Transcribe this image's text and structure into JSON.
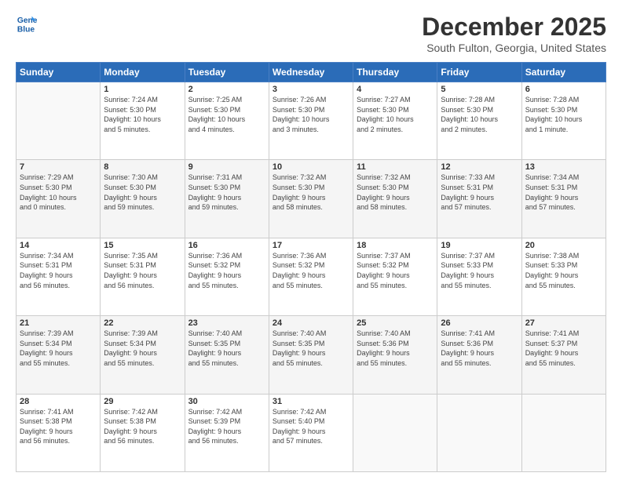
{
  "header": {
    "logo_line1": "General",
    "logo_line2": "Blue",
    "title": "December 2025",
    "subtitle": "South Fulton, Georgia, United States"
  },
  "days_of_week": [
    "Sunday",
    "Monday",
    "Tuesday",
    "Wednesday",
    "Thursday",
    "Friday",
    "Saturday"
  ],
  "weeks": [
    [
      {
        "day": "",
        "info": ""
      },
      {
        "day": "1",
        "info": "Sunrise: 7:24 AM\nSunset: 5:30 PM\nDaylight: 10 hours\nand 5 minutes."
      },
      {
        "day": "2",
        "info": "Sunrise: 7:25 AM\nSunset: 5:30 PM\nDaylight: 10 hours\nand 4 minutes."
      },
      {
        "day": "3",
        "info": "Sunrise: 7:26 AM\nSunset: 5:30 PM\nDaylight: 10 hours\nand 3 minutes."
      },
      {
        "day": "4",
        "info": "Sunrise: 7:27 AM\nSunset: 5:30 PM\nDaylight: 10 hours\nand 2 minutes."
      },
      {
        "day": "5",
        "info": "Sunrise: 7:28 AM\nSunset: 5:30 PM\nDaylight: 10 hours\nand 2 minutes."
      },
      {
        "day": "6",
        "info": "Sunrise: 7:28 AM\nSunset: 5:30 PM\nDaylight: 10 hours\nand 1 minute."
      }
    ],
    [
      {
        "day": "7",
        "info": "Sunrise: 7:29 AM\nSunset: 5:30 PM\nDaylight: 10 hours\nand 0 minutes."
      },
      {
        "day": "8",
        "info": "Sunrise: 7:30 AM\nSunset: 5:30 PM\nDaylight: 9 hours\nand 59 minutes."
      },
      {
        "day": "9",
        "info": "Sunrise: 7:31 AM\nSunset: 5:30 PM\nDaylight: 9 hours\nand 59 minutes."
      },
      {
        "day": "10",
        "info": "Sunrise: 7:32 AM\nSunset: 5:30 PM\nDaylight: 9 hours\nand 58 minutes."
      },
      {
        "day": "11",
        "info": "Sunrise: 7:32 AM\nSunset: 5:30 PM\nDaylight: 9 hours\nand 58 minutes."
      },
      {
        "day": "12",
        "info": "Sunrise: 7:33 AM\nSunset: 5:31 PM\nDaylight: 9 hours\nand 57 minutes."
      },
      {
        "day": "13",
        "info": "Sunrise: 7:34 AM\nSunset: 5:31 PM\nDaylight: 9 hours\nand 57 minutes."
      }
    ],
    [
      {
        "day": "14",
        "info": "Sunrise: 7:34 AM\nSunset: 5:31 PM\nDaylight: 9 hours\nand 56 minutes."
      },
      {
        "day": "15",
        "info": "Sunrise: 7:35 AM\nSunset: 5:31 PM\nDaylight: 9 hours\nand 56 minutes."
      },
      {
        "day": "16",
        "info": "Sunrise: 7:36 AM\nSunset: 5:32 PM\nDaylight: 9 hours\nand 55 minutes."
      },
      {
        "day": "17",
        "info": "Sunrise: 7:36 AM\nSunset: 5:32 PM\nDaylight: 9 hours\nand 55 minutes."
      },
      {
        "day": "18",
        "info": "Sunrise: 7:37 AM\nSunset: 5:32 PM\nDaylight: 9 hours\nand 55 minutes."
      },
      {
        "day": "19",
        "info": "Sunrise: 7:37 AM\nSunset: 5:33 PM\nDaylight: 9 hours\nand 55 minutes."
      },
      {
        "day": "20",
        "info": "Sunrise: 7:38 AM\nSunset: 5:33 PM\nDaylight: 9 hours\nand 55 minutes."
      }
    ],
    [
      {
        "day": "21",
        "info": "Sunrise: 7:39 AM\nSunset: 5:34 PM\nDaylight: 9 hours\nand 55 minutes."
      },
      {
        "day": "22",
        "info": "Sunrise: 7:39 AM\nSunset: 5:34 PM\nDaylight: 9 hours\nand 55 minutes."
      },
      {
        "day": "23",
        "info": "Sunrise: 7:40 AM\nSunset: 5:35 PM\nDaylight: 9 hours\nand 55 minutes."
      },
      {
        "day": "24",
        "info": "Sunrise: 7:40 AM\nSunset: 5:35 PM\nDaylight: 9 hours\nand 55 minutes."
      },
      {
        "day": "25",
        "info": "Sunrise: 7:40 AM\nSunset: 5:36 PM\nDaylight: 9 hours\nand 55 minutes."
      },
      {
        "day": "26",
        "info": "Sunrise: 7:41 AM\nSunset: 5:36 PM\nDaylight: 9 hours\nand 55 minutes."
      },
      {
        "day": "27",
        "info": "Sunrise: 7:41 AM\nSunset: 5:37 PM\nDaylight: 9 hours\nand 55 minutes."
      }
    ],
    [
      {
        "day": "28",
        "info": "Sunrise: 7:41 AM\nSunset: 5:38 PM\nDaylight: 9 hours\nand 56 minutes."
      },
      {
        "day": "29",
        "info": "Sunrise: 7:42 AM\nSunset: 5:38 PM\nDaylight: 9 hours\nand 56 minutes."
      },
      {
        "day": "30",
        "info": "Sunrise: 7:42 AM\nSunset: 5:39 PM\nDaylight: 9 hours\nand 56 minutes."
      },
      {
        "day": "31",
        "info": "Sunrise: 7:42 AM\nSunset: 5:40 PM\nDaylight: 9 hours\nand 57 minutes."
      },
      {
        "day": "",
        "info": ""
      },
      {
        "day": "",
        "info": ""
      },
      {
        "day": "",
        "info": ""
      }
    ]
  ]
}
